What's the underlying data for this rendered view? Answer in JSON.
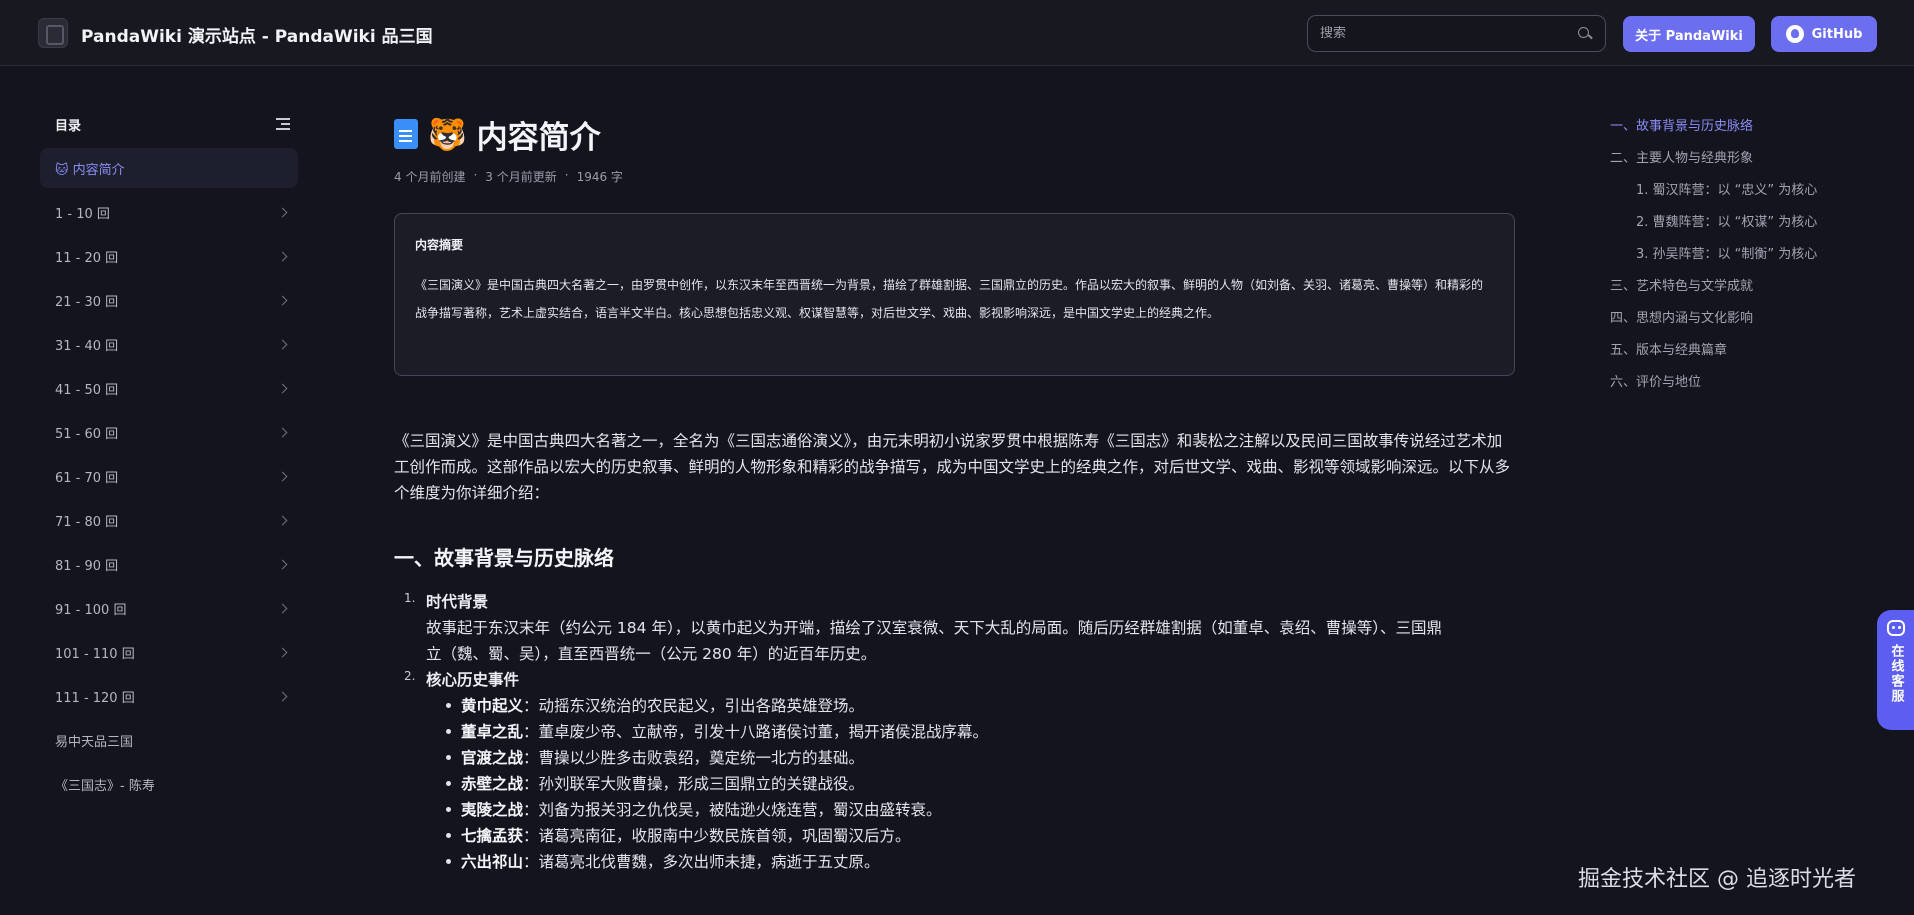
{
  "header": {
    "site_title": "PandaWiki 演示站点 - PandaWiki 品三国",
    "search_placeholder": "搜索",
    "about_button": "关于 PandaWiki",
    "github_button": "GitHub"
  },
  "sidebar": {
    "heading": "目录",
    "items": [
      {
        "label": "🐱 内容简介",
        "active": true,
        "chevron": false
      },
      {
        "label": "1 - 10 回",
        "chevron": true
      },
      {
        "label": "11 - 20 回",
        "chevron": true
      },
      {
        "label": "21 - 30 回",
        "chevron": true
      },
      {
        "label": "31 - 40 回",
        "chevron": true
      },
      {
        "label": "41 - 50 回",
        "chevron": true
      },
      {
        "label": "51 - 60 回",
        "chevron": true
      },
      {
        "label": "61 - 70 回",
        "chevron": true
      },
      {
        "label": "71 - 80 回",
        "chevron": true
      },
      {
        "label": "81 - 90 回",
        "chevron": true
      },
      {
        "label": "91 - 100 回",
        "chevron": true
      },
      {
        "label": "101 - 110 回",
        "chevron": true
      },
      {
        "label": "111 - 120 回",
        "chevron": true
      },
      {
        "label": "易中天品三国",
        "chevron": false
      },
      {
        "label": "《三国志》- 陈寿",
        "chevron": false
      }
    ]
  },
  "main": {
    "title_emoji": "🐯",
    "title": "内容简介",
    "meta": {
      "created": "4 个月前创建",
      "sep": "·",
      "updated": "3 个月前更新",
      "words": "1946 字"
    },
    "summary": {
      "title": "内容摘要",
      "text": "《三国演义》是中国古典四大名著之一，由罗贯中创作，以东汉末年至西晋统一为背景，描绘了群雄割据、三国鼎立的历史。作品以宏大的叙事、鲜明的人物（如刘备、关羽、诸葛亮、曹操等）和精彩的战争描写著称，艺术上虚实结合，语言半文半白。核心思想包括忠义观、权谋智慧等，对后世文学、戏曲、影视影响深远，是中国文学史上的经典之作。"
    },
    "intro": "《三国演义》是中国古典四大名著之一，全名为《三国志通俗演义》，由元末明初小说家罗贯中根据陈寿《三国志》和裴松之注解以及民间三国故事传说经过艺术加工创作而成。这部作品以宏大的历史叙事、鲜明的人物形象和精彩的战争描写，成为中国文学史上的经典之作，对后世文学、戏曲、影视等领域影响深远。以下从多个维度为你详细介绍：",
    "section1": {
      "heading": "一、故事背景与历史脉络",
      "items": [
        {
          "num": "1.",
          "title": "时代背景",
          "body": "故事起于东汉末年（约公元 184 年），以黄巾起义为开端，描绘了汉室衰微、天下大乱的局面。随后历经群雄割据（如董卓、袁绍、曹操等）、三国鼎立（魏、蜀、吴），直至西晋统一（公元 280 年）的近百年历史。"
        },
        {
          "num": "2.",
          "title": "核心历史事件",
          "events": [
            {
              "name": "黄巾起义",
              "desc": "：动摇东汉统治的农民起义，引出各路英雄登场。"
            },
            {
              "name": "董卓之乱",
              "desc": "：董卓废少帝、立献帝，引发十八路诸侯讨董，揭开诸侯混战序幕。"
            },
            {
              "name": "官渡之战",
              "desc": "：曹操以少胜多击败袁绍，奠定统一北方的基础。"
            },
            {
              "name": "赤壁之战",
              "desc": "：孙刘联军大败曹操，形成三国鼎立的关键战役。"
            },
            {
              "name": "夷陵之战",
              "desc": "：刘备为报关羽之仇伐吴，被陆逊火烧连营，蜀汉由盛转衰。"
            },
            {
              "name": "七擒孟获",
              "desc": "：诸葛亮南征，收服南中少数民族首领，巩固蜀汉后方。"
            },
            {
              "name": "六出祁山",
              "desc": "：诸葛亮北伐曹魏，多次出师未捷，病逝于五丈原。"
            }
          ]
        }
      ]
    }
  },
  "right_toc": {
    "items": [
      {
        "label": "一、故事背景与历史脉络",
        "active": true,
        "sub": false
      },
      {
        "label": "二、主要人物与经典形象",
        "sub": false
      },
      {
        "label": "1. 蜀汉阵营：以 “忠义” 为核心",
        "sub": true
      },
      {
        "label": "2. 曹魏阵营：以 “权谋” 为核心",
        "sub": true
      },
      {
        "label": "3. 孙吴阵营：以 “制衡” 为核心",
        "sub": true
      },
      {
        "label": "三、艺术特色与文学成就",
        "sub": false
      },
      {
        "label": "四、思想内涵与文化影响",
        "sub": false
      },
      {
        "label": "五、版本与经典篇章",
        "sub": false
      },
      {
        "label": "六、评价与地位",
        "sub": false
      }
    ]
  },
  "service": {
    "label": "在线客服"
  },
  "watermark": "掘金技术社区 @ 追逐时光者",
  "colors": {
    "accent": "#6c6ef0",
    "background": "#13141d"
  }
}
